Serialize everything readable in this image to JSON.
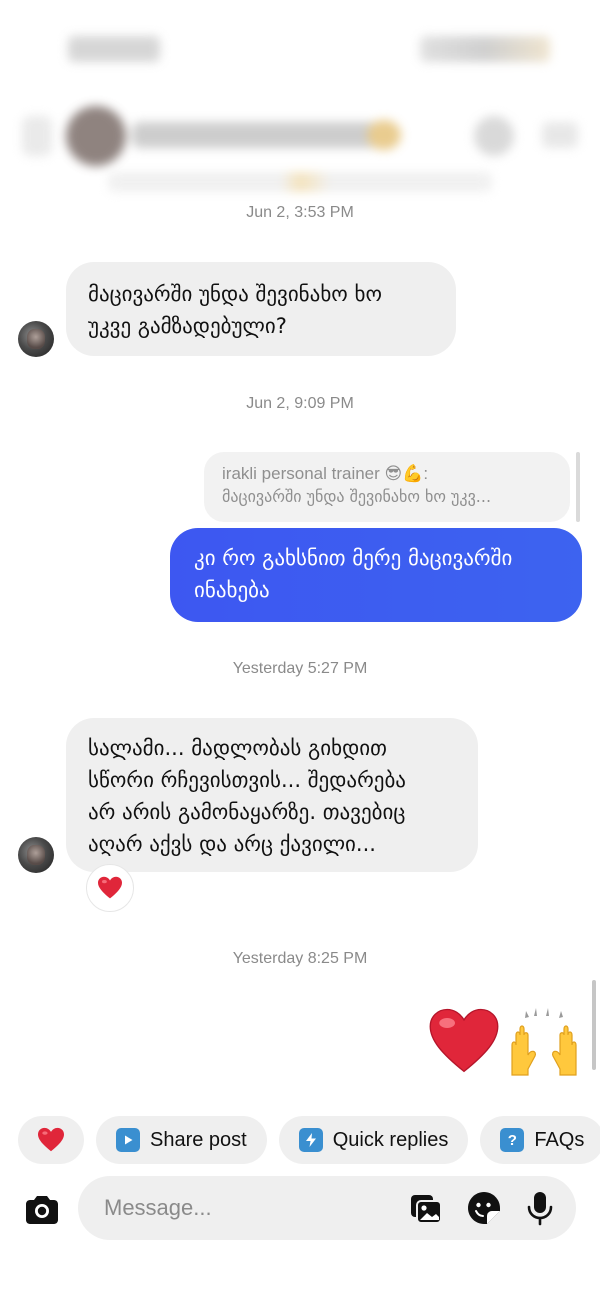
{
  "timestamps": {
    "t1": "Jun 2, 3:53 PM",
    "t2": "Jun 2, 9:09 PM",
    "t3": "Yesterday 5:27 PM",
    "t4": "Yesterday 8:25 PM"
  },
  "messages": {
    "incoming_1": [
      "მაცივარში უნდა შევინახო ხო",
      "უკვე გამზადებული?"
    ],
    "reply_preview": {
      "author": "irakli personal trainer 😎💪:",
      "quoted": "მაცივარში უნდა შევინახო ხო უკვ..."
    },
    "outgoing_1": [
      "კი რო გახსნით მერე მაცივარში",
      "ინახება"
    ],
    "incoming_2": [
      "სალამი... მადლობას გიხდით",
      "სწორი რჩევისთვის... შედარება",
      "არ არის გამონაყარზე. თავებიც",
      "აღარ აქვს და არც ქავილი..."
    ],
    "reaction_icon": "heart-emoji",
    "outgoing_emoji": "❤️🙌"
  },
  "quick_actions": {
    "heart_icon": "heart-emoji",
    "share_post": "Share post",
    "quick_replies": "Quick replies",
    "faqs": "FAQs"
  },
  "composer": {
    "placeholder": "Message...",
    "icons": [
      "camera-icon",
      "gallery-icon",
      "sticker-icon",
      "microphone-icon"
    ]
  },
  "colors": {
    "outgoing_bubble": "#3E5BF0",
    "incoming_bubble": "#EFEFEF",
    "heart": "#E0263A"
  }
}
